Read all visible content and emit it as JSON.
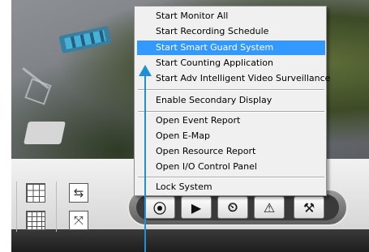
{
  "menu": {
    "items": [
      {
        "label": "Start Monitor All",
        "highlighted": false
      },
      {
        "label": "Start Recording Schedule",
        "highlighted": false
      },
      {
        "label": "Start Smart Guard System",
        "highlighted": true
      },
      {
        "label": "Start Counting Application",
        "highlighted": false
      },
      {
        "label": "Start Adv Intelligent Video Surveillance",
        "highlighted": false
      },
      {
        "label": "Enable Secondary Display",
        "highlighted": false
      },
      {
        "label": "Open Event Report",
        "highlighted": false
      },
      {
        "label": "Open E-Map",
        "highlighted": false
      },
      {
        "label": "Open Resource Report",
        "highlighted": false
      },
      {
        "label": "Open I/O Control Panel",
        "highlighted": false
      },
      {
        "label": "Lock System",
        "highlighted": false
      }
    ]
  },
  "toolbar": {
    "buttons": [
      {
        "icon": "record-icon",
        "glyph": "⦿"
      },
      {
        "icon": "playback-icon",
        "glyph": "▶"
      },
      {
        "icon": "schedule-icon",
        "glyph": "⏲"
      },
      {
        "icon": "alert-icon",
        "glyph": "⚠"
      },
      {
        "icon": "tools-icon",
        "glyph": "⚒"
      }
    ]
  },
  "layout_buttons": {
    "swap_glyph": "⇆",
    "fullscreen_glyph": "⤧"
  },
  "colors": {
    "menu_highlight": "#3399ff",
    "callout_arrow": "#1f8fd6"
  }
}
